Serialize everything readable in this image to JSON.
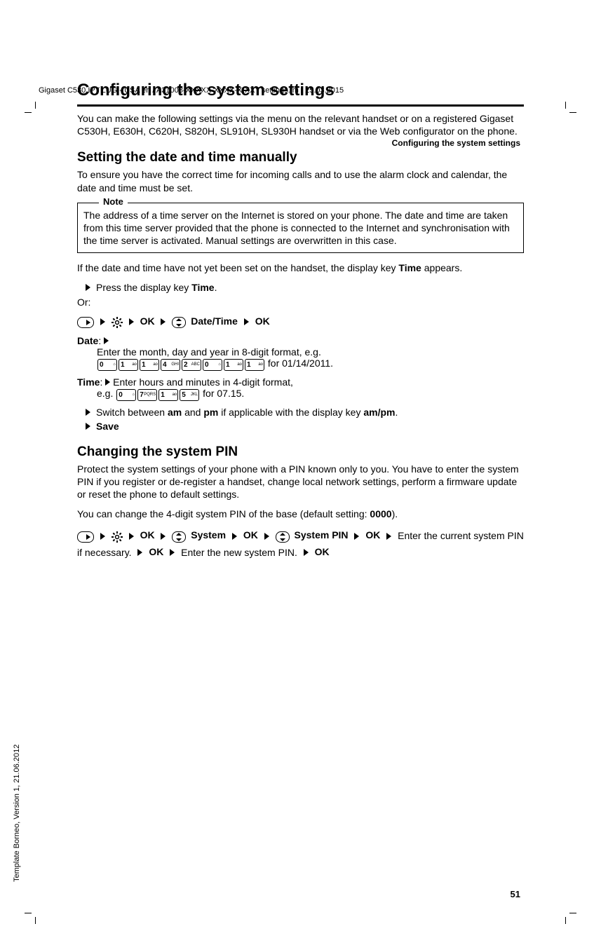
{
  "meta": {
    "top_header": "Gigaset C530 IP / LUG - USA en / A31008-XXXXX-XXXX-X-XX / settings.fm / 25.03.2015",
    "side_text": "Template Borneo, Version 1, 21.06.2012",
    "page_number": "51",
    "running_header": "Configuring the system settings"
  },
  "h1": "Configuring the system settings",
  "intro": "You can make the following settings via the menu on the relevant handset or on a registered Gigaset C530H, E630H, C620H, S820H, SL910H, SL930H handset or via the Web configurator on the phone.",
  "sec1": {
    "title": "Setting the date and time manually",
    "p1": "To ensure you have the correct time for incoming calls and to use the alarm clock and calendar, the date and time must be set.",
    "note_label": "Note",
    "note_body": "The address of a time server on the Internet is stored on your phone. The date and time are taken from this time server provided that the phone is connected to the Internet and synchronisation with the time server is activated. Manual settings are overwritten in this case.",
    "p2a": "If the date and time have not yet been set on the handset, the display key ",
    "p2b": " appears.",
    "time_key": "Time",
    "press_a": "Press the display key ",
    "press_time": "Time",
    "press_b": ".",
    "or": "Or:",
    "ok": "OK",
    "date_time": "Date/Time",
    "date_label": "Date",
    "date_colon": ": ",
    "date_line1": "Enter the month, day and year in 8-digit format, e.g.",
    "date_line2": " for 01/14/2011.",
    "keys_date": [
      {
        "d": "0",
        "l": "⌂"
      },
      {
        "d": "1",
        "l": "ao"
      },
      {
        "d": "1",
        "l": "ao"
      },
      {
        "d": "4",
        "l": "GHI"
      },
      {
        "d": "2",
        "l": "ABC"
      },
      {
        "d": "0",
        "l": "⌂"
      },
      {
        "d": "1",
        "l": "ao"
      },
      {
        "d": "1",
        "l": "ao"
      }
    ],
    "time_label": "Time",
    "time_line1": "Enter hours and minutes in 4-digit format,",
    "time_line2a": "e.g. ",
    "time_line2b": " for 07.15.",
    "keys_time": [
      {
        "d": "0",
        "l": "⌂"
      },
      {
        "d": "7",
        "l": "PQRS"
      },
      {
        "d": "1",
        "l": "ao"
      },
      {
        "d": "5",
        "l": "JKL"
      }
    ],
    "switch_a": "Switch between ",
    "am": "am",
    "switch_b": " and ",
    "pm": "pm",
    "switch_c": " if applicable with the display key ",
    "ampm": "am/pm",
    "switch_d": ".",
    "save": "Save"
  },
  "sec2": {
    "title": "Changing the system PIN",
    "p1": "Protect the system settings of your phone with a PIN known only to you. You have to enter the system PIN if you register or de-register a handset, change local network settings, perform a firmware update or reset the phone to default settings.",
    "p2a": "You can change the 4-digit system PIN of the base (default setting: ",
    "p2b": ").",
    "default_pin": "0000",
    "system": "System",
    "system_pin": "System PIN",
    "enter_current": "Enter the current system PIN if necessary.",
    "enter_new": "Enter the new system PIN."
  }
}
